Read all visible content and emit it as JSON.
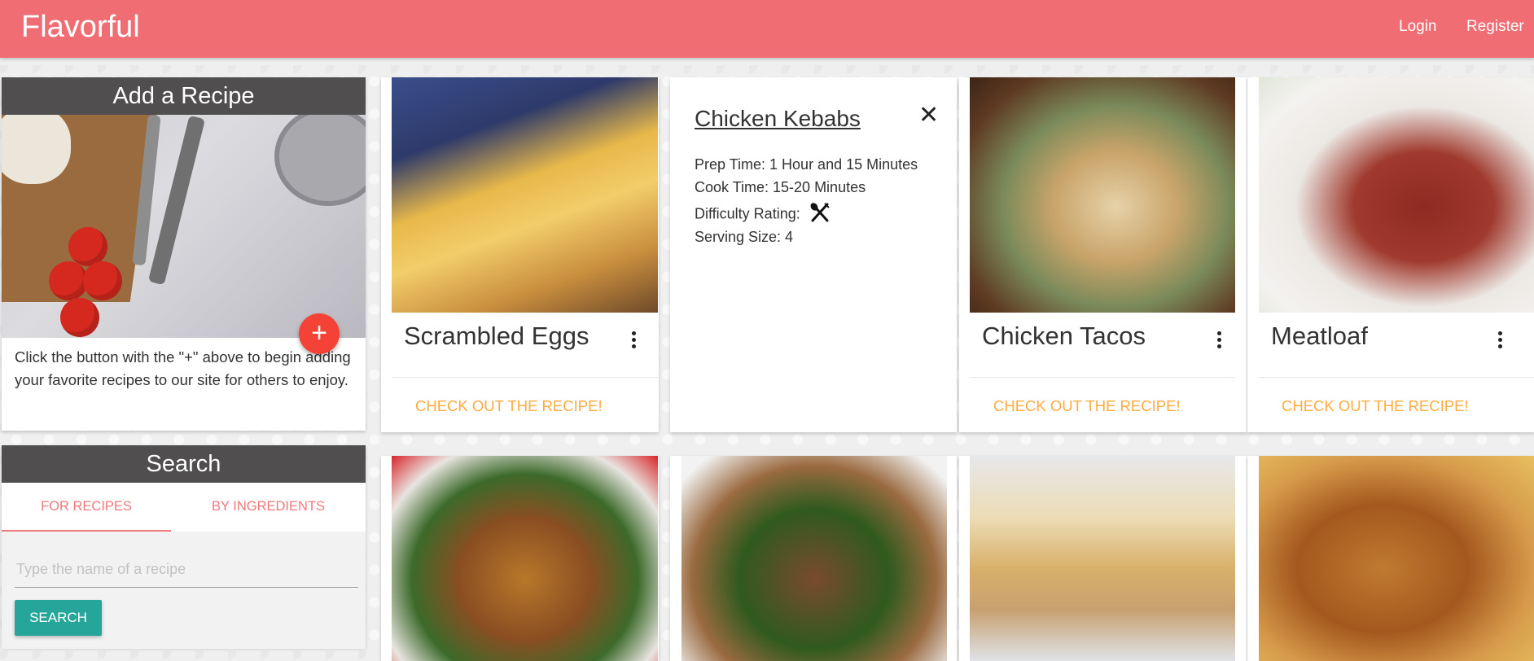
{
  "navbar": {
    "brand": "Flavorful",
    "login": "Login",
    "register": "Register"
  },
  "add_recipe": {
    "title": "Add a Recipe",
    "fab_label": "+",
    "description": "Click the button with the \"+\" above to begin adding your favorite recipes to our site for others to enjoy."
  },
  "search": {
    "title": "Search",
    "tabs": [
      "FOR RECIPES",
      "BY INGREDIENTS"
    ],
    "active_tab": "FOR RECIPES",
    "placeholder": "Type the name of a recipe",
    "value": "",
    "button": "SEARCH"
  },
  "recipes": [
    {
      "title": "Scrambled Eggs",
      "link": "CHECK OUT THE RECIPE!"
    },
    {
      "title": "Chicken Kebabs",
      "link": ""
    },
    {
      "title": "Chicken Tacos",
      "link": "CHECK OUT THE RECIPE!"
    },
    {
      "title": "Meatloaf",
      "link": "CHECK OUT THE RECIPE!"
    }
  ],
  "reveal": {
    "title": "Chicken Kebabs",
    "prep": "Prep Time: 1 Hour and 15 Minutes",
    "cook": "Cook Time: 15-20 Minutes",
    "difficulty": "Difficulty Rating:",
    "difficulty_level": 1,
    "serving": "Serving Size: 4"
  },
  "colors": {
    "primary": "#ef6d73",
    "accent_link": "#ffab40",
    "search_button": "#26a69a",
    "fab": "#f44336",
    "header_dark": "#504e4e"
  },
  "icons": [
    "plus-icon",
    "more-vert-icon",
    "close-icon",
    "utensils-icon"
  ]
}
